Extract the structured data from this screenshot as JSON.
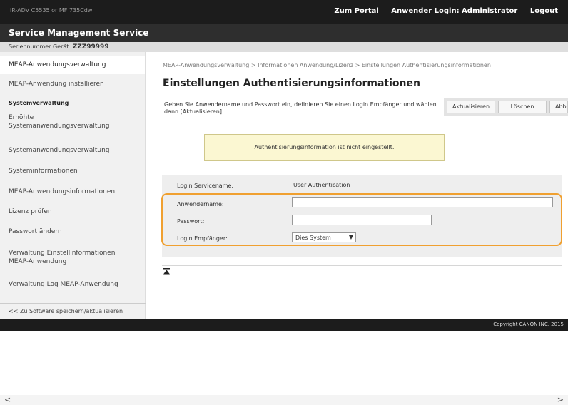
{
  "topbar": {
    "device_name": "iR-ADV C5535 or MF 735Cdw",
    "portal_link": "Zum Portal",
    "login_info": "Anwender Login: Administrator",
    "logout_link": "Logout"
  },
  "titlebar": {
    "title": "Service Management Service"
  },
  "serial": {
    "label": "Seriennummer Gerät:",
    "value": "ZZZ99999"
  },
  "sidebar": {
    "items": [
      {
        "lines": [
          "MEAP-Anwendungsverwaltung"
        ]
      },
      {
        "lines": [
          "MEAP-Anwendung installieren"
        ]
      },
      {
        "lines": [
          "Systemverwaltung"
        ]
      },
      {
        "lines": [
          "Erhöhte",
          "Systemanwendungsverwaltung"
        ]
      },
      {
        "lines": [
          "Systemanwendungsverwaltung"
        ]
      },
      {
        "lines": [
          "Systeminformationen"
        ]
      },
      {
        "lines": [
          "MEAP-Anwendungsinformationen"
        ]
      },
      {
        "lines": [
          "Lizenz prüfen"
        ]
      },
      {
        "lines": [
          "Passwort ändern"
        ]
      },
      {
        "lines": [
          "Verwaltung Einstellinformationen",
          "MEAP-Anwendung"
        ]
      },
      {
        "lines": [
          "Verwaltung Log MEAP-Anwendung"
        ]
      },
      {
        "lines": [
          "<< Zu Software speichern/aktualisieren"
        ]
      }
    ]
  },
  "main": {
    "breadcrumb": "MEAP-Anwendungsverwaltung > Informationen Anwendung/Lizenz > Einstellungen Authentisierungsinformationen",
    "title": "Einstellungen Authentisierungsinformationen",
    "description": "Geben Sie Anwendername und Passwort ein, definieren Sie einen Login Empfänger und wählen dann [Aktualisieren].",
    "buttons": {
      "update": "Aktualisieren",
      "delete": "Löschen",
      "back": "Abbrechen"
    },
    "alert": "Authentisierungsinformation ist nicht eingestellt.",
    "form": {
      "service_label": "Login Servicename:",
      "service_value": "User Authentication",
      "username_label": "Anwendername:",
      "username_value": "",
      "password_label": "Passwort:",
      "password_value": "",
      "destination_label": "Login Empfänger:",
      "destination_value": "Dies System"
    }
  },
  "footer": {
    "copyright": "Copyright CANON INC. 2015"
  },
  "scrollbar": {
    "left_arrow": "<",
    "right_arrow": ">"
  },
  "icons": {
    "top_icon": "jump-to-top-icon",
    "chevron": "chevron-down-icon"
  },
  "colors": {
    "highlight": "#f0a030",
    "alert_background": "#fbf7d2",
    "topbar": "#1c1c1c"
  }
}
